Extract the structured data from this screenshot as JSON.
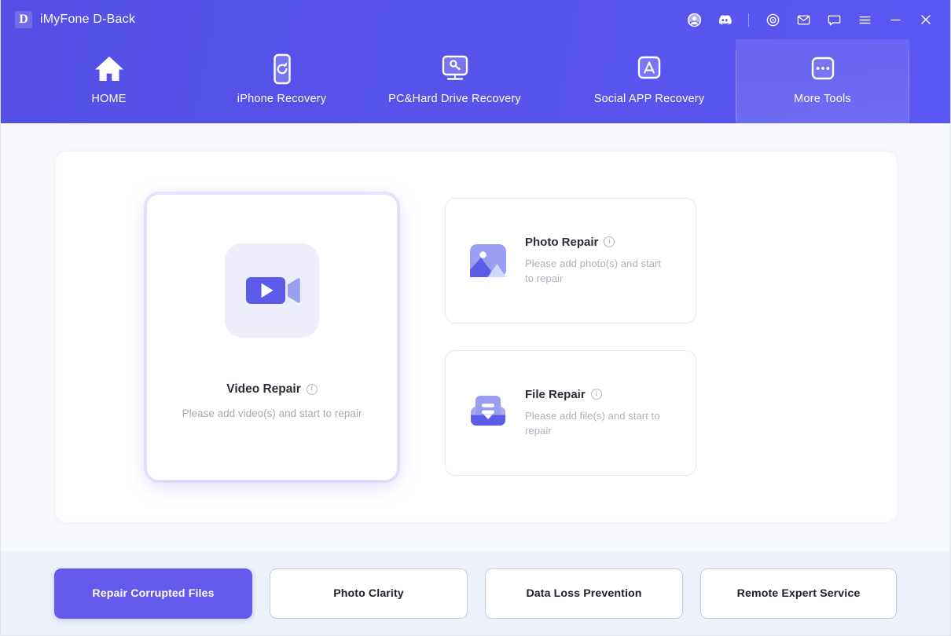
{
  "window": {
    "app_title": "iMyFone D-Back",
    "logo_letter": "D",
    "accent_color": "#6459ea",
    "header_gradient_from": "#5450e6",
    "header_gradient_to": "#5b57f4",
    "page_background": "#f7f8fc",
    "bottom_background": "#edf1fa"
  },
  "titlebar": {
    "icons": [
      {
        "name": "user-avatar-icon",
        "label": "Account"
      },
      {
        "name": "discord-icon",
        "label": "Discord"
      },
      {
        "name": "separator",
        "label": ""
      },
      {
        "name": "target-icon",
        "label": "Activate"
      },
      {
        "name": "mail-icon",
        "label": "Mail"
      },
      {
        "name": "chat-icon",
        "label": "Feedback"
      },
      {
        "name": "hamburger-menu-icon",
        "label": "Menu"
      },
      {
        "name": "minimize-icon",
        "label": "Minimize"
      },
      {
        "name": "close-icon",
        "label": "Close"
      }
    ]
  },
  "nav": {
    "tabs": [
      {
        "label": "HOME",
        "icon": "home-icon",
        "active": false
      },
      {
        "label": "iPhone Recovery",
        "icon": "phone-refresh-icon",
        "active": false
      },
      {
        "label": "PC&Hard Drive Recovery",
        "icon": "monitor-key-icon",
        "active": false
      },
      {
        "label": "Social APP Recovery",
        "icon": "app-store-icon",
        "active": false
      },
      {
        "label": "More Tools",
        "icon": "ellipsis-box-icon",
        "active": true
      }
    ]
  },
  "main": {
    "featured": {
      "title": "Video Repair",
      "description": "Please add video(s) and start to repair",
      "icon": "video-camera-icon",
      "info": "i"
    },
    "cards": [
      {
        "title": "Photo Repair",
        "description": "Please add photo(s) and start to repair",
        "icon": "photo-image-icon",
        "info": "i"
      },
      {
        "title": "File Repair",
        "description": "Please add file(s) and start to repair",
        "icon": "file-document-icon",
        "info": "i"
      }
    ]
  },
  "bottom": {
    "buttons": [
      {
        "label": "Repair Corrupted Files",
        "primary": true
      },
      {
        "label": "Photo Clarity",
        "primary": false
      },
      {
        "label": "Data Loss Prevention",
        "primary": false
      },
      {
        "label": "Remote Expert Service",
        "primary": false
      }
    ]
  }
}
